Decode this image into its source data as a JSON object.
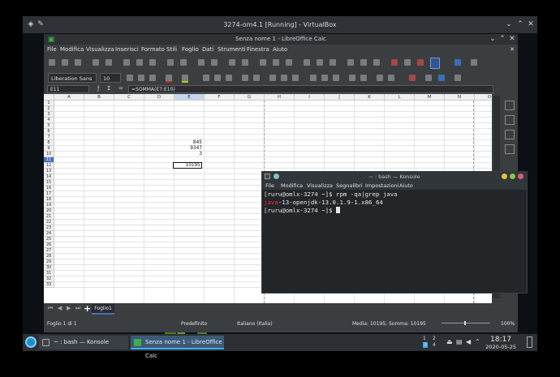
{
  "vbox": {
    "title": "3274-om4.1 [Running] - VirtualBox"
  },
  "calc": {
    "title": "Senza nome 1 - LibreOffice Calc",
    "menu": [
      "File",
      "Modifica",
      "Visualizza",
      "Inserisci",
      "Formato",
      "Stili",
      "Foglio",
      "Dati",
      "Strumenti",
      "Finestra",
      "Aiuto"
    ],
    "font_name": "Liberation Sans",
    "font_size": "10",
    "name_box": "E11",
    "formula": "=SOMMA(E7:E10)",
    "columns": [
      "A",
      "B",
      "C",
      "D",
      "E",
      "F",
      "G",
      "H",
      "I",
      "J",
      "K",
      "L",
      "M",
      "N",
      "O"
    ],
    "selected_column": "E",
    "rows": [
      "1",
      "2",
      "3",
      "4",
      "5",
      "6",
      "7",
      "8",
      "9",
      "10",
      "11",
      "12",
      "13",
      "14",
      "15",
      "16",
      "17",
      "18",
      "19",
      "20",
      "21",
      "22",
      "23",
      "24",
      "25",
      "26",
      "27",
      "28",
      "29",
      "30",
      "31",
      "32",
      "33"
    ],
    "selected_row": "11",
    "cells": {
      "e7": "845",
      "e8": "9347",
      "e9": "3",
      "e11": "10195"
    },
    "sheet_tab": "Foglio1",
    "status": {
      "sheet": "Foglio 1 di 1",
      "style": "Predefinito",
      "language": "Italiano (Italia)",
      "summary": "Media: 10195; Somma: 10195",
      "zoom": "100%"
    }
  },
  "konsole": {
    "title": "~ : bash — Konsole",
    "menu": [
      "File",
      "Modifica",
      "Visualizza",
      "Segnalibri",
      "Impostazioni",
      "Aiuto"
    ],
    "line1": "[ruru@omlx-3274 ~]$ rpm -qa|grep java",
    "line2_highlight": "java",
    "line2_rest": "-13-openjdk-13.0.1.9-1.x86_64",
    "line3": "[ruru@omlx-3274 ~]$ "
  },
  "taskbar": {
    "task1": "~ : bash — Konsole",
    "task2": "Senza nome 1 - LibreOffice Calc",
    "pager": [
      "1",
      "2",
      "3",
      "4"
    ],
    "time": "18:17",
    "date": "2020-05-25"
  },
  "colors": {
    "selection": "#4472c4",
    "terminal_bg": "#232629",
    "error_red": "#ee3333"
  }
}
